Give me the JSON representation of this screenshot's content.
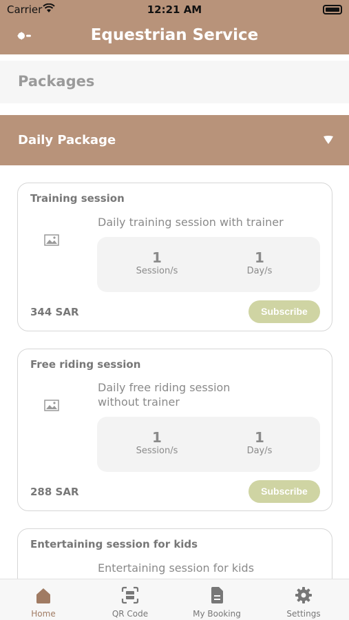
{
  "status_bar": {
    "carrier": "Carrier",
    "time": "12:21 AM"
  },
  "nav": {
    "title": "Equestrian Service",
    "back_icon": "back-arrow-icon"
  },
  "section": {
    "title": "Packages"
  },
  "accordion": {
    "title": "Daily Package",
    "expanded": true
  },
  "colors": {
    "brand": "#b8937a",
    "subscribe": "#cfd4a3"
  },
  "packages": [
    {
      "name": "Training session",
      "description": "Daily training session with trainer",
      "sessions": "1",
      "sessions_unit": "Session/s",
      "days": "1",
      "days_unit": "Day/s",
      "price": "344 SAR",
      "button": "Subscribe"
    },
    {
      "name": "Free riding session",
      "description": "Daily free riding session without trainer",
      "sessions": "1",
      "sessions_unit": "Session/s",
      "days": "1",
      "days_unit": "Day/s",
      "price": "288 SAR",
      "button": "Subscribe"
    },
    {
      "name": "Entertaining session for kids",
      "description": "Entertaining session for kids"
    }
  ],
  "tabs": [
    {
      "label": "Home",
      "icon": "home-icon",
      "active": true
    },
    {
      "label": "QR Code",
      "icon": "qr-code-icon",
      "active": false
    },
    {
      "label": "My Booking",
      "icon": "booking-document-icon",
      "active": false
    },
    {
      "label": "Settings",
      "icon": "gear-icon",
      "active": false
    }
  ]
}
